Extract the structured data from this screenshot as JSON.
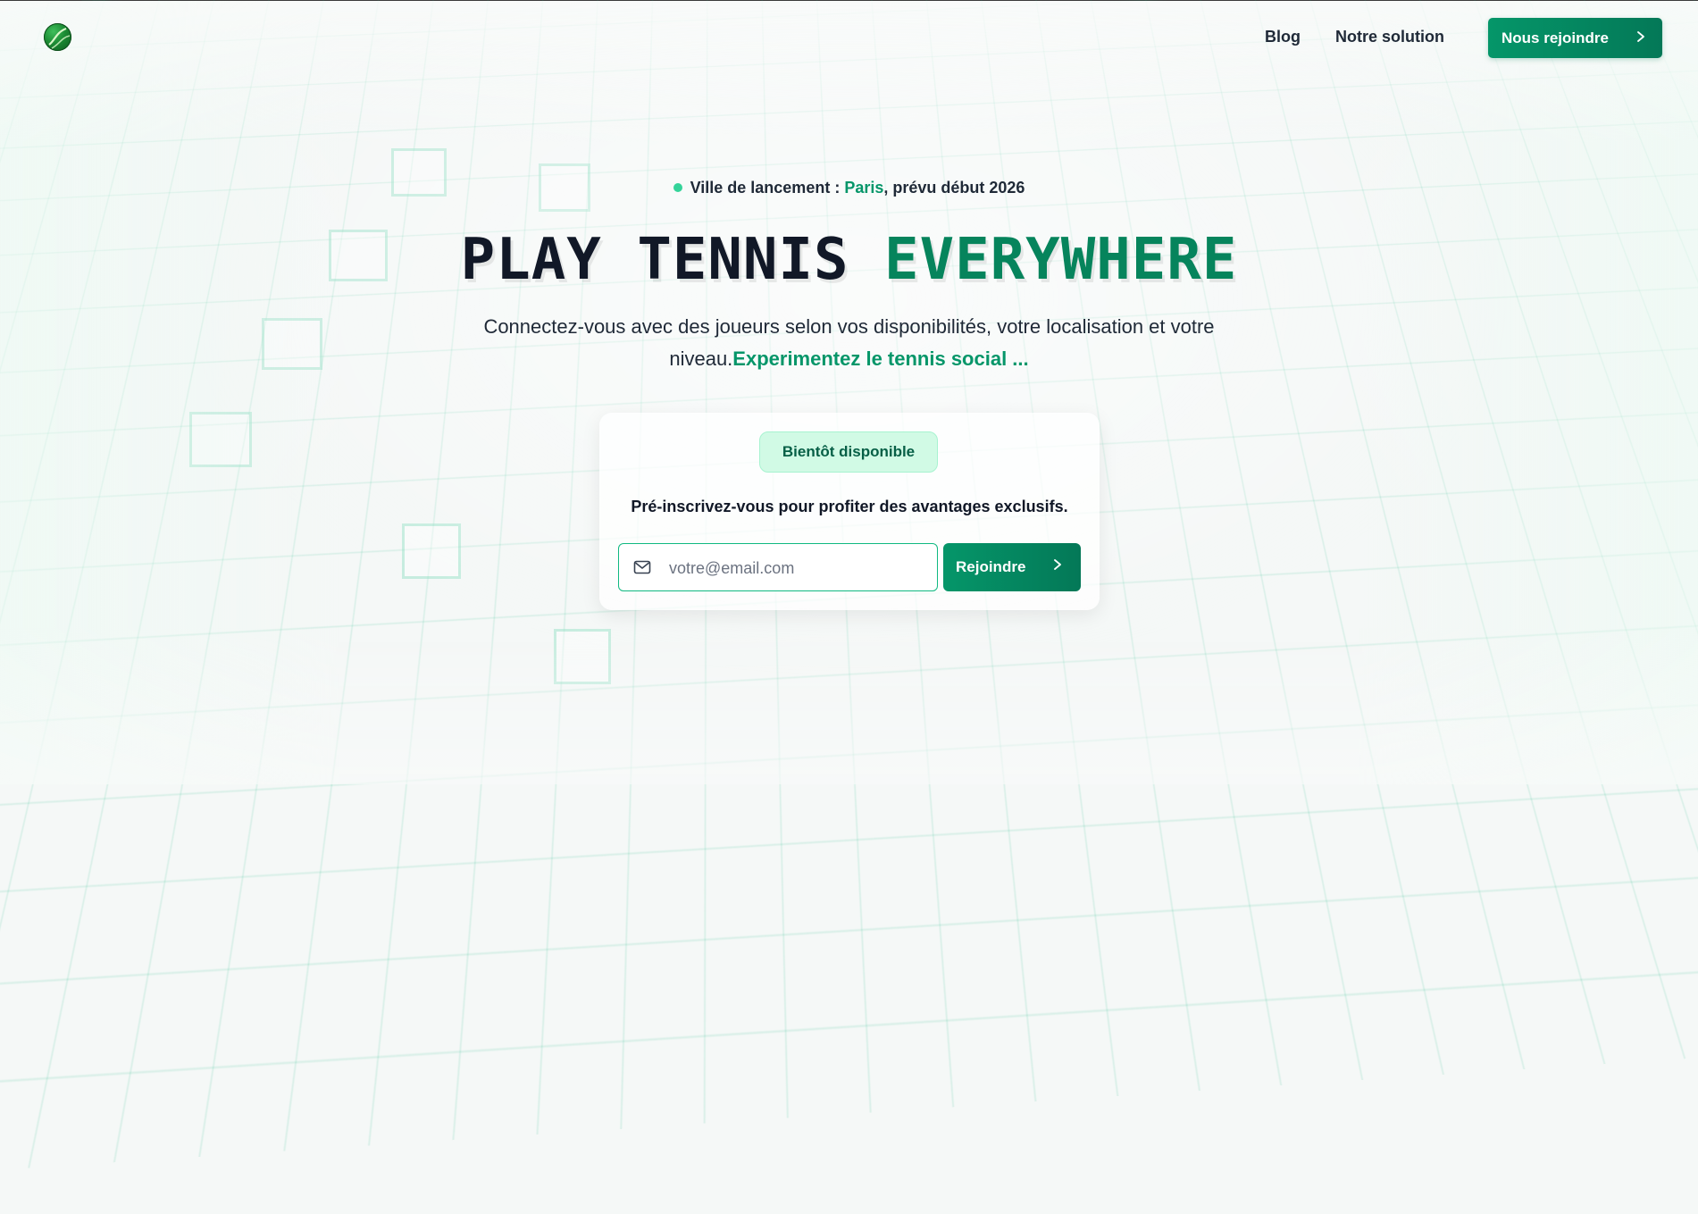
{
  "nav": {
    "logo_icon": "tennis-ball-logo-icon",
    "links": [
      "Blog",
      "Notre solution"
    ],
    "join_label": "Nous rejoindre",
    "join_icon": "chevron-right-icon"
  },
  "hero": {
    "launch_prefix": "Ville de lancement : ",
    "launch_city": "Paris",
    "launch_suffix": ", prévu début 2026",
    "title_part1": "PLAY TENNIS",
    "title_part2": "EVERYWHERE",
    "subtitle": "Connectez-vous avec des joueurs selon vos disponibilités, votre localisation et votre niveau.",
    "subtitle_accent": "Experimentez le tennis social ..."
  },
  "signup": {
    "badge": "Bientôt disponible",
    "text": "Pré-inscrivez-vous pour profiter des avantages exclusifs.",
    "email_placeholder": "votre@email.com",
    "email_value": "",
    "email_icon": "mail-icon",
    "submit_label": "Rejoindre",
    "submit_icon": "chevron-right-icon"
  },
  "colors": {
    "brand": "#059669",
    "brand_dark": "#047857",
    "badge_bg": "#d1fae5",
    "text_dark": "#111827"
  }
}
